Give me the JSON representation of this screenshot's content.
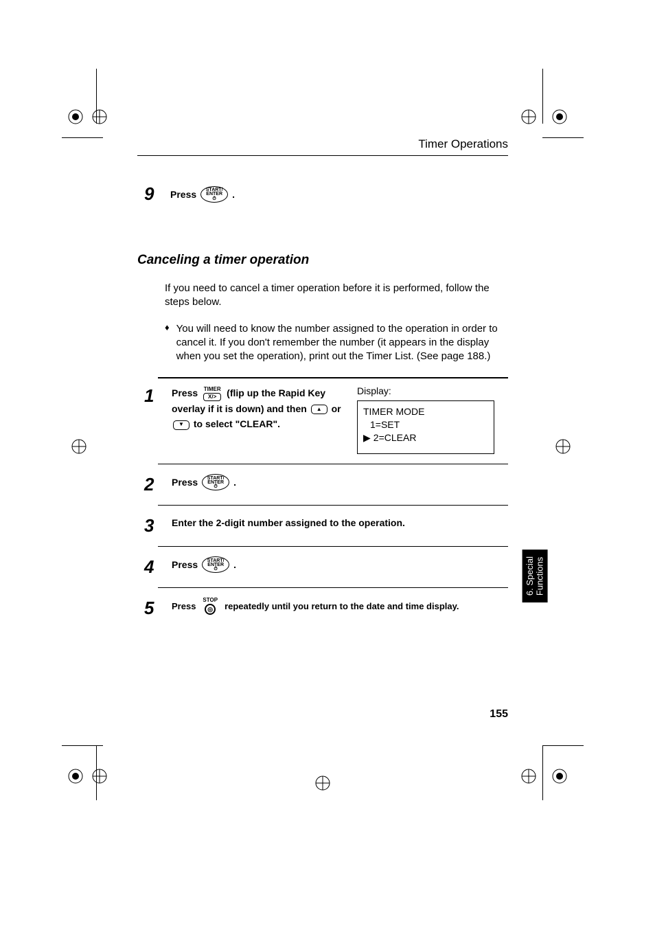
{
  "header": "Timer Operations",
  "section_title": "Canceling a timer operation",
  "intro": "If you need to cancel a timer operation before it is performed, follow the steps below.",
  "bullet": "You will need to know the number assigned to the operation in order to cancel it. If you don't remember the number (it appears in the display when you set the operation), print out the Timer List. (See page 188.)",
  "press_word": "Press",
  "period": ".",
  "start_enter": {
    "top": "START/",
    "mid": "ENTER"
  },
  "timer_key": {
    "top": "TIMER",
    "slot": "X/>"
  },
  "stop_key": {
    "label": "STOP"
  },
  "step9": {
    "num": "9"
  },
  "step1": {
    "num": "1",
    "frag1": "(flip up the Rapid Key",
    "frag2": "overlay if it is down) and then",
    "frag3": "or",
    "frag4": "to select \"CLEAR\"."
  },
  "display": {
    "label": "Display:",
    "line1": "TIMER MODE",
    "line2": "1=SET",
    "line3": "2=CLEAR"
  },
  "step2": {
    "num": "2"
  },
  "step3": {
    "num": "3",
    "text": "Enter the 2-digit number assigned to the operation."
  },
  "step4": {
    "num": "4"
  },
  "step5": {
    "num": "5",
    "frag1": "repeatedly until you return to the date and time display."
  },
  "side_tab": "6. Special\nFunctions",
  "page_number": "155"
}
